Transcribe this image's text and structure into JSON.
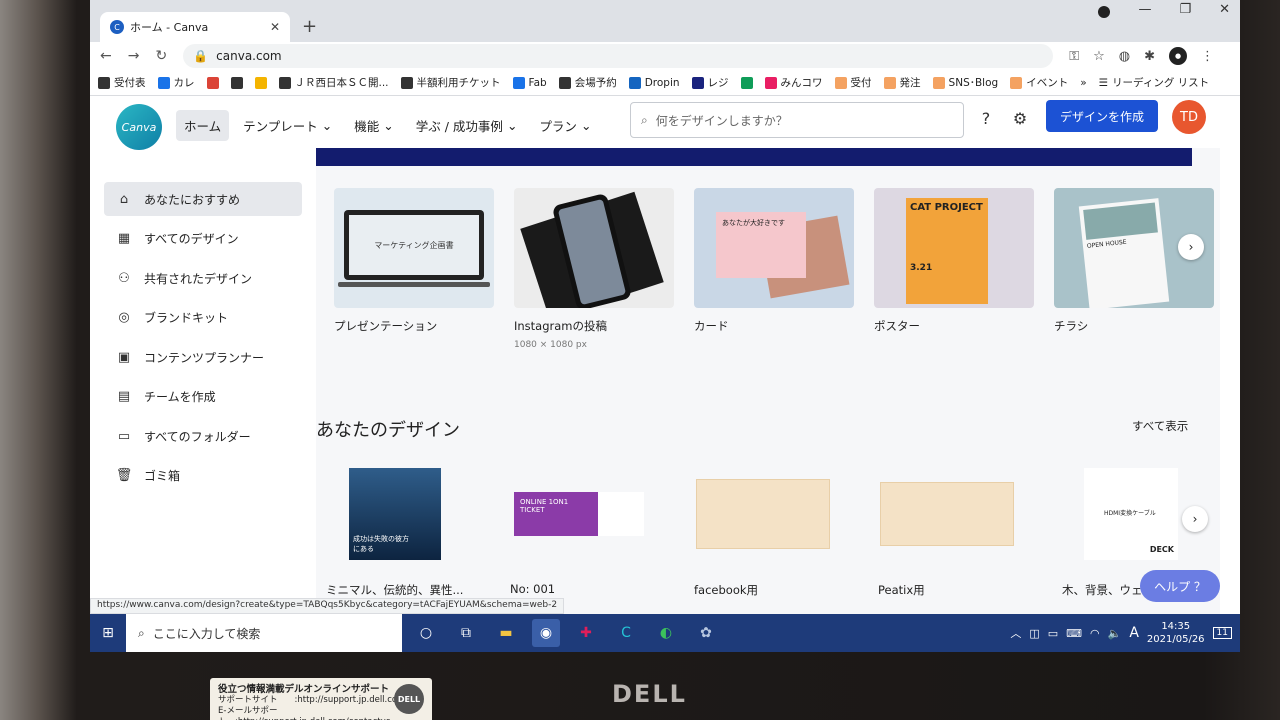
{
  "browser": {
    "tab_title": "ホーム - Canva",
    "url": "canva.com",
    "bookmarks": [
      {
        "label": "受付表",
        "color": "#333333"
      },
      {
        "label": "カレ",
        "color": "#1a73e8"
      },
      {
        "label": "",
        "color": "#db4437"
      },
      {
        "label": "",
        "color": "#333333"
      },
      {
        "label": "",
        "color": "#f4b400"
      },
      {
        "label": "ＪＲ西日本ＳＣ開...",
        "color": "#333333"
      },
      {
        "label": "半額利用チケット",
        "color": "#333333"
      },
      {
        "label": "Fab",
        "color": "#1a73e8"
      },
      {
        "label": "会場予約",
        "color": "#333333"
      },
      {
        "label": "Dropin",
        "color": "#1565c0"
      },
      {
        "label": "レジ",
        "color": "#1a237e"
      },
      {
        "label": "",
        "color": "#0f9d58"
      },
      {
        "label": "みんコワ",
        "color": "#e91e63"
      },
      {
        "label": "受付",
        "color": "#f4a261"
      },
      {
        "label": "発注",
        "color": "#f4a261"
      },
      {
        "label": "SNS･Blog",
        "color": "#f4a261"
      },
      {
        "label": "イベント",
        "color": "#f4a261"
      }
    ],
    "reading_list": "リーディング リスト",
    "status_url": "https://www.canva.com/design?create&type=TABQqs5Kbyc&category=tACFajEYUAM&schema=web-2"
  },
  "canva": {
    "logo_text": "Canva",
    "nav": [
      {
        "label": "ホーム",
        "active": true
      },
      {
        "label": "テンプレート",
        "active": false
      },
      {
        "label": "機能",
        "active": false
      },
      {
        "label": "学ぶ / 成功事例",
        "active": false
      },
      {
        "label": "プラン",
        "active": false
      }
    ],
    "search_placeholder": "何をデザインしますか？",
    "create_button": "デザインを作成",
    "user_initials": "TD",
    "sidebar": [
      {
        "label": "あなたにおすすめ",
        "active": true
      },
      {
        "label": "すべてのデザイン",
        "active": false
      },
      {
        "label": "共有されたデザイン",
        "active": false
      },
      {
        "label": "ブランドキット",
        "active": false
      },
      {
        "label": "コンテンツプランナー",
        "active": false
      },
      {
        "label": "チームを作成",
        "active": false
      },
      {
        "label": "すべてのフォルダー",
        "active": false
      },
      {
        "label": "ゴミ箱",
        "active": false
      }
    ],
    "templates": [
      {
        "label": "プレゼンテーション",
        "sub": "",
        "bg": "#dfe8ef"
      },
      {
        "label": "Instagramの投稿",
        "sub": "1080 × 1080 px",
        "bg": "#ececec"
      },
      {
        "label": "カード",
        "sub": "",
        "bg": "#c9d7e6"
      },
      {
        "label": "ポスター",
        "sub": "",
        "bg": "#ddd8e2"
      },
      {
        "label": "チラシ",
        "sub": "",
        "bg": "#a9c2c9"
      }
    ],
    "section_title": "あなたのデザイン",
    "view_all": "すべて表示",
    "designs": [
      {
        "label": "ミニマル、伝統的、異性..."
      },
      {
        "label": "No: 001"
      },
      {
        "label": "facebook用"
      },
      {
        "label": "Peatix用"
      },
      {
        "label": "木、背景、ウェディ..."
      }
    ],
    "help_button": "ヘルプ ？",
    "thumb_texts": {
      "presentation": "マーケティング企画書",
      "card": "あなたが大好きです",
      "poster_title": "CAT PROJECT",
      "poster_date": "3.21",
      "flyer": "OPEN HOUSE",
      "d1": "成功は失敗の彼方にある",
      "d2": "ONLINE 1ON1 TICKET",
      "d5": "HDMI変換ケーブル",
      "d5_brand": "DECK"
    }
  },
  "taskbar": {
    "search_placeholder": "ここに入力して検索",
    "time": "14:35",
    "date": "2021/05/26",
    "ime": "A",
    "notifications": "11"
  },
  "monitor": {
    "brand": "DELL",
    "sticker_title": "役立つ情報満載デルオンラインサポート",
    "sticker_line1": "サポートサイト　　:http://support.jp.dell.com",
    "sticker_line2": "E-メールサポート　:http://support.jp.dell.com/contactus",
    "sticker_badge": "DELL"
  }
}
